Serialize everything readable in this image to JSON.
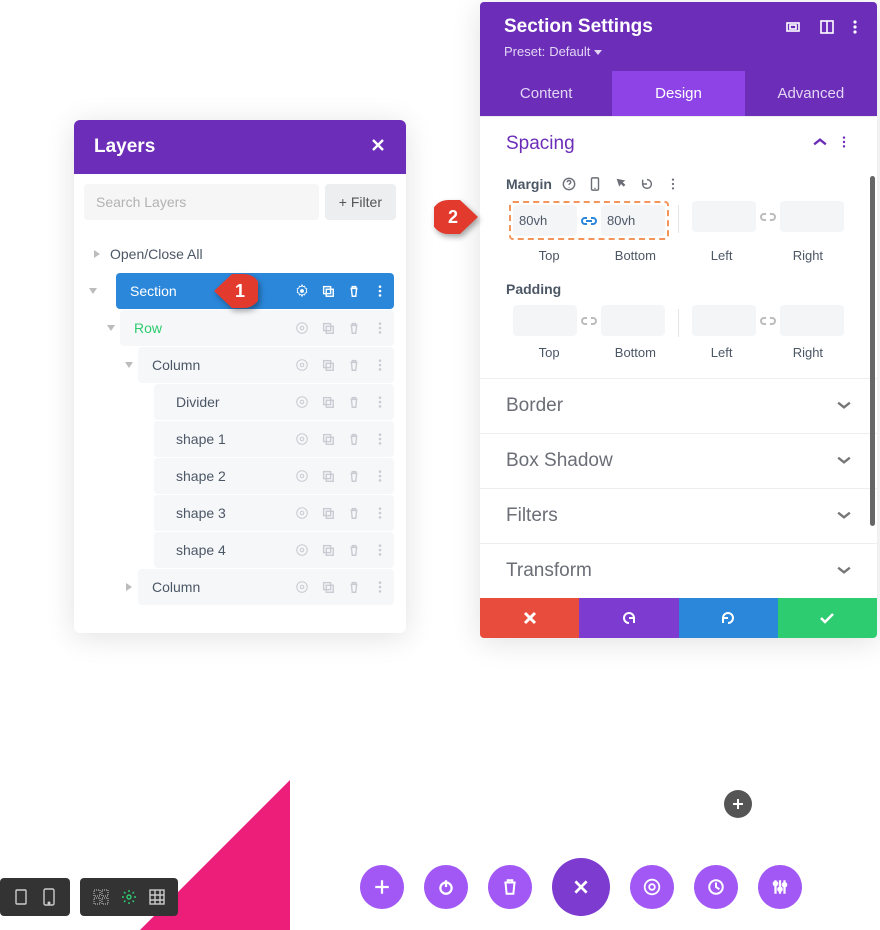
{
  "layers": {
    "title": "Layers",
    "search_placeholder": "Search Layers",
    "filter_label": "Filter",
    "open_close_all": "Open/Close All",
    "section": "Section",
    "row": "Row",
    "column": "Column",
    "modules": [
      "Divider",
      "shape 1",
      "shape 2",
      "shape 3",
      "shape 4"
    ]
  },
  "settings": {
    "title": "Section Settings",
    "preset_label": "Preset:",
    "preset_value": "Default",
    "tabs": {
      "content": "Content",
      "design": "Design",
      "advanced": "Advanced"
    },
    "spacing": {
      "title": "Spacing",
      "margin_label": "Margin",
      "padding_label": "Padding",
      "top": "Top",
      "bottom": "Bottom",
      "left": "Left",
      "right": "Right",
      "margin_top_value": "80vh",
      "margin_bottom_value": "80vh",
      "margin_left_value": "",
      "margin_right_value": "",
      "padding_top_value": "",
      "padding_bottom_value": "",
      "padding_left_value": "",
      "padding_right_value": ""
    },
    "border": "Border",
    "box_shadow": "Box Shadow",
    "filters": "Filters",
    "transform": "Transform"
  },
  "markers": {
    "m1": "1",
    "m2": "2"
  }
}
